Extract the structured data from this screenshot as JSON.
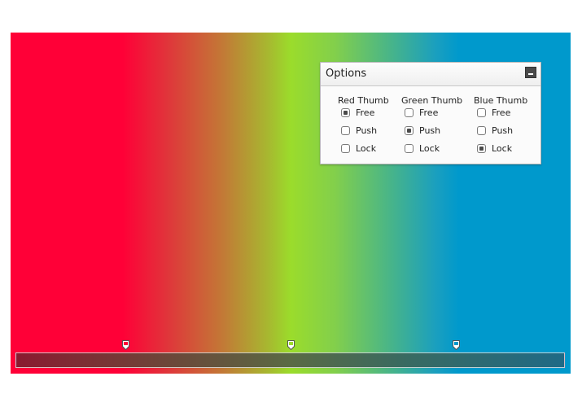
{
  "options": {
    "title": "Options",
    "minimize_icon": "minimize-icon",
    "columns": [
      {
        "header": "Red Thumb",
        "items": [
          {
            "label": "Free",
            "checked": true
          },
          {
            "label": "Push",
            "checked": false
          },
          {
            "label": "Lock",
            "checked": false
          }
        ]
      },
      {
        "header": "Green Thumb",
        "items": [
          {
            "label": "Free",
            "checked": false
          },
          {
            "label": "Push",
            "checked": true
          },
          {
            "label": "Lock",
            "checked": false
          }
        ]
      },
      {
        "header": "Blue Thumb",
        "items": [
          {
            "label": "Free",
            "checked": false
          },
          {
            "label": "Push",
            "checked": false
          },
          {
            "label": "Lock",
            "checked": true
          }
        ]
      }
    ]
  },
  "colors": {
    "red": "#ff0037",
    "green": "#9bdc2b",
    "blue": "#0099cc"
  }
}
